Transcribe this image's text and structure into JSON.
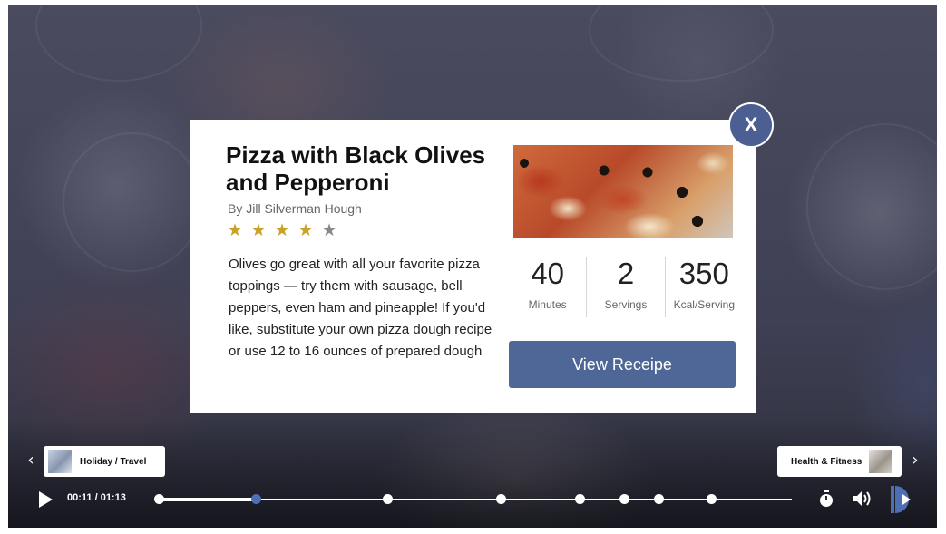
{
  "recipe": {
    "title": "Pizza with Black Olives and Pepperoni",
    "author": "By Jill Silverman Hough",
    "rating": 4,
    "rating_max": 5,
    "description": "Olives go great with all your favorite pizza toppings — try them with sausage, bell peppers, even ham and pineapple! If you'd like, substitute your own pizza dough recipe or use 12 to 16 ounces of prepared dough",
    "stats": [
      {
        "value": "40",
        "label": "Minutes"
      },
      {
        "value": "2",
        "label": "Servings"
      },
      {
        "value": "350",
        "label": "Kcal/Serving"
      }
    ],
    "button_label": "View Receipe",
    "close_label": "X",
    "image_icon": "pizza-photo"
  },
  "navigation": {
    "prev_label": "Holiday / Travel",
    "next_label": "Health & Fitness",
    "prev_icon": "chevron-left-icon",
    "next_icon": "chevron-right-icon"
  },
  "player": {
    "time": "00:11 / 01:13",
    "progress": 0.153,
    "markers": [
      0.0,
      0.153,
      0.361,
      0.54,
      0.665,
      0.735,
      0.79,
      0.873
    ],
    "current_marker_index": 1,
    "icons": [
      "play-icon",
      "timer-icon",
      "volume-icon",
      "logo-icon"
    ]
  },
  "colors": {
    "accent": "#4f6796",
    "close_button": "#4b5f93",
    "star_on": "#c9a227",
    "star_off": "#888888",
    "current_marker": "#4d6fb3"
  }
}
